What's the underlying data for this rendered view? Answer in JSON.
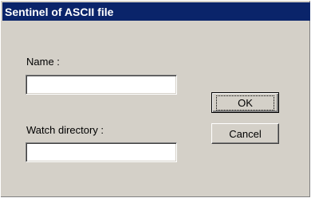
{
  "window": {
    "title": "Sentinel of ASCII file"
  },
  "form": {
    "name_label": "Name :",
    "name_value": "",
    "watch_label": "Watch directory :",
    "watch_value": ""
  },
  "buttons": {
    "ok_label": "OK",
    "cancel_label": "Cancel"
  },
  "colors": {
    "titlebar": "#0a246a",
    "dialog_face": "#d4d0c8"
  }
}
